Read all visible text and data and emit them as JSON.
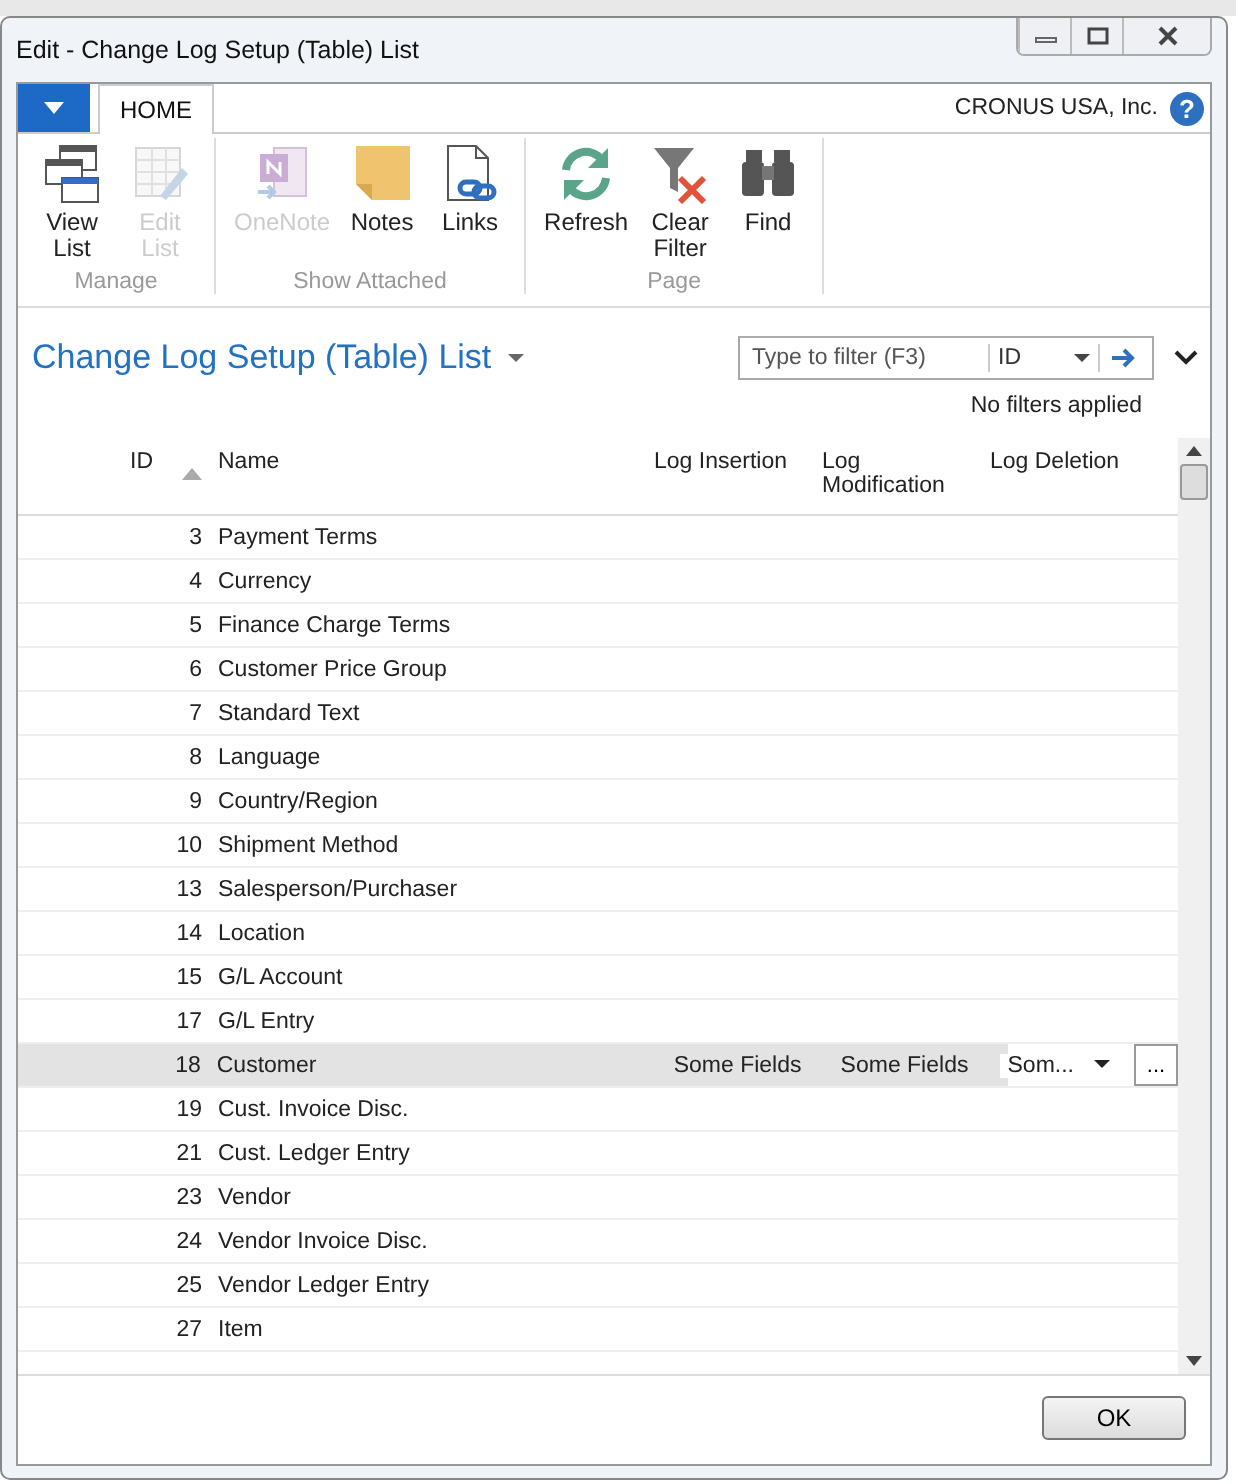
{
  "window": {
    "title": "Edit - Change Log Setup (Table) List"
  },
  "ribbon": {
    "tabs": [
      {
        "label": "HOME",
        "selected": true
      }
    ],
    "company": "CRONUS USA, Inc.",
    "help": "?",
    "groups": [
      {
        "label": "Manage",
        "actions": [
          {
            "kind": "view-list",
            "label": "View List",
            "disabled": false
          },
          {
            "kind": "edit-list",
            "label": "Edit List",
            "disabled": true
          }
        ]
      },
      {
        "label": "Show Attached",
        "actions": [
          {
            "kind": "onenote",
            "label": "OneNote",
            "disabled": true
          },
          {
            "kind": "notes",
            "label": "Notes",
            "disabled": false
          },
          {
            "kind": "links",
            "label": "Links",
            "disabled": false
          }
        ]
      },
      {
        "label": "Page",
        "actions": [
          {
            "kind": "refresh",
            "label": "Refresh",
            "disabled": false
          },
          {
            "kind": "clear-filter",
            "label": "Clear Filter",
            "disabled": false
          },
          {
            "kind": "find",
            "label": "Find",
            "disabled": false
          }
        ]
      }
    ]
  },
  "page": {
    "title": "Change Log Setup (Table) List",
    "filter": {
      "placeholder": "Type to filter (F3)",
      "field": "ID"
    },
    "filter_status": "No filters applied"
  },
  "table": {
    "columns": [
      {
        "label": "ID",
        "sorted": true
      },
      {
        "label": "Name",
        "sorted": false
      },
      {
        "label": "Log Insertion",
        "sorted": false
      },
      {
        "label": "Log Modification",
        "sorted": false
      },
      {
        "label": "Log Deletion",
        "sorted": false
      }
    ],
    "rows": [
      {
        "id": "3",
        "name": "Payment Terms",
        "selected": false
      },
      {
        "id": "4",
        "name": "Currency",
        "selected": false
      },
      {
        "id": "5",
        "name": "Finance Charge Terms",
        "selected": false
      },
      {
        "id": "6",
        "name": "Customer Price Group",
        "selected": false
      },
      {
        "id": "7",
        "name": "Standard Text",
        "selected": false
      },
      {
        "id": "8",
        "name": "Language",
        "selected": false
      },
      {
        "id": "9",
        "name": "Country/Region",
        "selected": false
      },
      {
        "id": "10",
        "name": "Shipment Method",
        "selected": false
      },
      {
        "id": "13",
        "name": "Salesperson/Purchaser",
        "selected": false
      },
      {
        "id": "14",
        "name": "Location",
        "selected": false
      },
      {
        "id": "15",
        "name": "G/L Account",
        "selected": false
      },
      {
        "id": "17",
        "name": "G/L Entry",
        "selected": false
      },
      {
        "id": "18",
        "name": "Customer",
        "log_insertion": "Some Fields",
        "log_modification": "Some Fields",
        "log_deletion": "Som...",
        "selected": true,
        "assist_button": "..."
      },
      {
        "id": "19",
        "name": "Cust. Invoice Disc.",
        "selected": false
      },
      {
        "id": "21",
        "name": "Cust. Ledger Entry",
        "selected": false
      },
      {
        "id": "23",
        "name": "Vendor",
        "selected": false
      },
      {
        "id": "24",
        "name": "Vendor Invoice Disc.",
        "selected": false
      },
      {
        "id": "25",
        "name": "Vendor Ledger Entry",
        "selected": false
      },
      {
        "id": "27",
        "name": "Item",
        "selected": false
      }
    ]
  },
  "buttons": [
    "OK"
  ]
}
